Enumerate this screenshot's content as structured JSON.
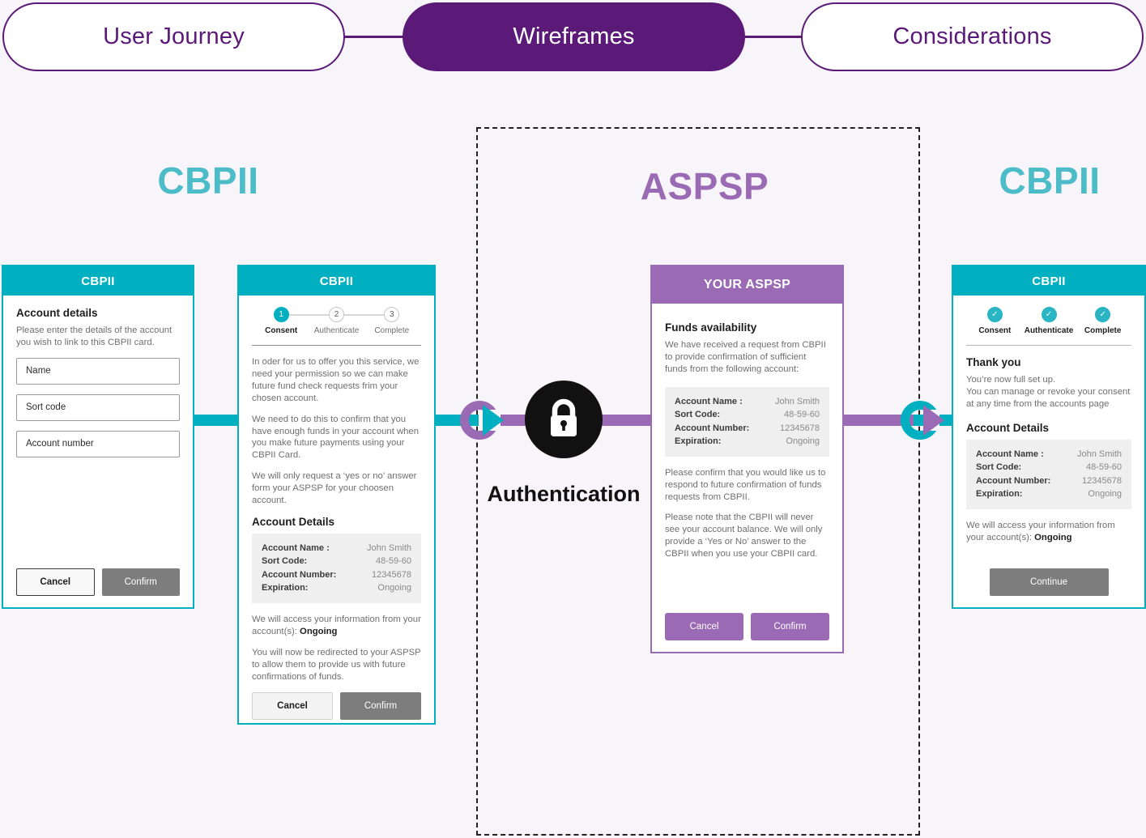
{
  "nav": {
    "tabs": [
      {
        "label": "User Journey",
        "style": "outline"
      },
      {
        "label": "Wireframes",
        "style": "filled"
      },
      {
        "label": "Considerations",
        "style": "outline"
      }
    ],
    "colors": {
      "accent": "#5b1a78",
      "text_on_fill": "#ffffff"
    }
  },
  "lanes": {
    "left": {
      "label": "CBPII",
      "color": "#4cbcc9"
    },
    "middle": {
      "label": "ASPSP",
      "color": "#9a6ab4"
    },
    "right": {
      "label": "CBPII",
      "color": "#4cbcc9"
    }
  },
  "authentication": {
    "label": "Authentication",
    "icon": "lock-icon",
    "circle_color": "#111111"
  },
  "account": {
    "rows": [
      {
        "key": "Account Name :",
        "value": "John Smith"
      },
      {
        "key": "Sort Code:",
        "value": "48-59-60"
      },
      {
        "key": "Account Number:",
        "value": "12345678"
      },
      {
        "key": "Expiration:",
        "value": "Ongoing"
      }
    ]
  },
  "phone1": {
    "header": "CBPII",
    "title": "Account details",
    "intro": "Please enter the details of the account you wish to link to this CBPII card.",
    "fields": [
      {
        "value": "Name"
      },
      {
        "value": "Sort code"
      },
      {
        "value": "Account number"
      }
    ],
    "cancel": "Cancel",
    "confirm": "Confirm"
  },
  "phone2": {
    "header": "CBPII",
    "steps": [
      {
        "num": "1",
        "label": "Consent",
        "state": "active"
      },
      {
        "num": "2",
        "label": "Authenticate",
        "state": "inactive"
      },
      {
        "num": "3",
        "label": "Complete",
        "state": "inactive"
      }
    ],
    "para1": "In oder for us to offer you this service, we need your permission so we can make future fund check requests frim your chosen account.",
    "para2": "We need to do this to confirm that you have enough funds in your account when you make future payments using your CBPII Card.",
    "para3": "We will only request a ‘yes or no’ answer form your ASPSP for your choosen account.",
    "details_title": "Account Details",
    "footer1_prefix": "We will access your information from your account(s): ",
    "footer1_bold": "Ongoing",
    "footer2": "You will now be redirected to your ASPSP to allow them to provide us with future confirmations of funds.",
    "cancel": "Cancel",
    "confirm": "Confirm"
  },
  "phone3": {
    "header": "YOUR ASPSP",
    "title": "Funds availability",
    "intro": "We have received a request from CBPII to provide confirmation of sufficient funds from the following account:",
    "para1": "Please confirm that you would like us to respond to future confirmation of funds requests from CBPII.",
    "para2": "Please note that the CBPII will never see your account balance. We will only provide a ‘Yes or No’ answer to the CBPII when you use your CBPII card.",
    "cancel": "Cancel",
    "confirm": "Confirm"
  },
  "phone4": {
    "header": "CBPII",
    "steps": [
      {
        "num": "✓",
        "label": "Consent",
        "state": "done"
      },
      {
        "num": "✓",
        "label": "Authenticate",
        "state": "done"
      },
      {
        "num": "✓",
        "label": "Complete",
        "state": "done"
      }
    ],
    "title": "Thank you",
    "intro_line1": "You’re now full set up.",
    "intro_line2": "You can manage or revoke your consent at any time from the accounts page",
    "details_title": "Account Details",
    "footer_prefix": "We will access your information from your account(s): ",
    "footer_bold": "Ongoing",
    "continue": "Continue"
  }
}
